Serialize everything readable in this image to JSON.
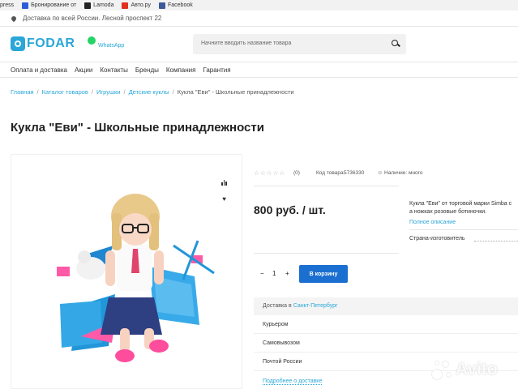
{
  "bookmarks": [
    {
      "label": "press",
      "color": ""
    },
    {
      "label": "Бронирование от",
      "color": "#2b5bd7"
    },
    {
      "label": "Lamoda",
      "color": "#222222"
    },
    {
      "label": "Авто.ру",
      "color": "#e0301e"
    },
    {
      "label": "Facebook",
      "color": "#3b5998"
    }
  ],
  "topbar": {
    "delivery_text": "Доставка по всей России. Лесной проспект 22"
  },
  "header": {
    "logo_text": "FODAR",
    "whatsapp_label": "WhatsApp",
    "search_placeholder": "Начните вводить название товара"
  },
  "nav": {
    "items": [
      "Оплата и доставка",
      "Акции",
      "Контакты",
      "Бренды",
      "Компания",
      "Гарантия"
    ]
  },
  "breadcrumbs": [
    "Главная",
    "Каталог товаров",
    "Игрушки",
    "Детские куклы",
    "Кукла \"Еви\" - Школьные принадлежности"
  ],
  "product": {
    "title": "Кукла \"Еви\" - Школьные принадлежности",
    "stars": "☆☆☆☆☆",
    "rating_count": "(0)",
    "code_label": "Код товара:",
    "code": "5736330",
    "stock_icon": "⊘",
    "stock": "Наличие: много",
    "price": "800 руб. / шт.",
    "description_lines": [
      "Кукла \"Еви\" от торговой марки Simba с",
      "а ножках розовые ботиночки."
    ],
    "full_description_link": "Полное описание",
    "country_label": "Страна-изготовитель",
    "quantity": {
      "minus": "−",
      "value": "1",
      "plus": "+"
    },
    "cart_button": "В корзину"
  },
  "delivery": {
    "header_prefix": "Доставка в",
    "city": "Санкт-Петербург",
    "options": [
      "Курьером",
      "Самовывозом",
      "Почтой России"
    ],
    "more_link": "Подробнее о доставке"
  },
  "watermark": {
    "text": "Avito"
  },
  "colors": {
    "accent": "#2aa7d8",
    "button": "#1b6fd1",
    "whatsapp": "#25d366"
  },
  "icons": [
    "location-pin-icon",
    "search-icon",
    "whatsapp-icon",
    "compare-icon",
    "heart-icon",
    "star-icon",
    "stock-status-icon"
  ]
}
